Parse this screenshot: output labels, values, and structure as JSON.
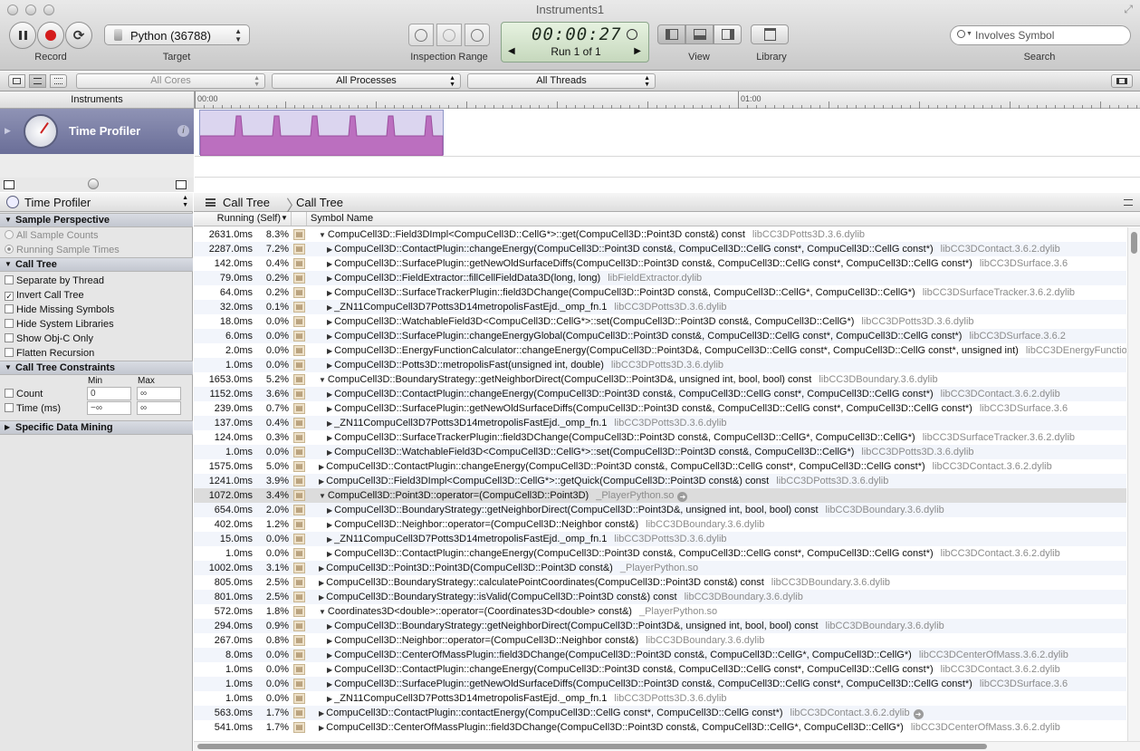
{
  "window": {
    "title": "Instruments1"
  },
  "toolbar": {
    "record_label": "Record",
    "target_label": "Target",
    "target_value": "Python (36788)",
    "inspection_label": "Inspection Range",
    "timer": "00:00:27",
    "run_label": "Run 1 of 1",
    "view_label": "View",
    "library_label": "Library",
    "search_placeholder": "Involves Symbol",
    "search_label": "Search"
  },
  "scopebar": {
    "cores": "All Cores",
    "processes": "All Processes",
    "threads": "All Threads"
  },
  "instruments": {
    "header": "Instruments",
    "ruler_ticks": [
      "00:00",
      "01:00"
    ],
    "items": [
      {
        "name": "Time Profiler",
        "info": "i"
      }
    ]
  },
  "left_panel": {
    "title": "Time Profiler",
    "sections": {
      "sample_perspective": "Sample Perspective",
      "call_tree": "Call Tree",
      "constraints": "Call Tree Constraints",
      "data_mining": "Specific Data Mining"
    },
    "perspective_options": [
      "All Sample Counts",
      "Running Sample Times"
    ],
    "call_tree_options": [
      {
        "label": "Separate by Thread",
        "checked": false
      },
      {
        "label": "Invert Call Tree",
        "checked": true
      },
      {
        "label": "Hide Missing Symbols",
        "checked": false
      },
      {
        "label": "Hide System Libraries",
        "checked": false
      },
      {
        "label": "Show Obj-C Only",
        "checked": false
      },
      {
        "label": "Flatten Recursion",
        "checked": false
      }
    ],
    "constraints": {
      "min_label": "Min",
      "max_label": "Max",
      "count_label": "Count",
      "count_min": "0",
      "count_max": "∞",
      "time_label": "Time (ms)",
      "time_min": "−∞",
      "time_max": "∞"
    }
  },
  "detail": {
    "breadcrumb": [
      "Call Tree",
      "Call Tree"
    ],
    "columns": {
      "running": "Running (Self)",
      "symbol": "Symbol Name"
    },
    "rows": [
      {
        "ms": "2631.0ms",
        "pct": "8.3%",
        "indent": 0,
        "tri": "▼",
        "sym": "CompuCell3D::Field3DImpl<CompuCell3D::CellG*>::get(CompuCell3D::Point3D const&) const",
        "lib": "libCC3DPotts3D.3.6.dylib"
      },
      {
        "ms": "2287.0ms",
        "pct": "7.2%",
        "indent": 1,
        "tri": "▶",
        "sym": "CompuCell3D::ContactPlugin::changeEnergy(CompuCell3D::Point3D const&, CompuCell3D::CellG const*, CompuCell3D::CellG const*)",
        "lib": "libCC3DContact.3.6.2.dylib"
      },
      {
        "ms": "142.0ms",
        "pct": "0.4%",
        "indent": 1,
        "tri": "▶",
        "sym": "CompuCell3D::SurfacePlugin::getNewOldSurfaceDiffs(CompuCell3D::Point3D const&, CompuCell3D::CellG const*, CompuCell3D::CellG const*)",
        "lib": "libCC3DSurface.3.6"
      },
      {
        "ms": "79.0ms",
        "pct": "0.2%",
        "indent": 1,
        "tri": "▶",
        "sym": "CompuCell3D::FieldExtractor::fillCellFieldData3D(long, long)",
        "lib": "libFieldExtractor.dylib"
      },
      {
        "ms": "64.0ms",
        "pct": "0.2%",
        "indent": 1,
        "tri": "▶",
        "sym": "CompuCell3D::SurfaceTrackerPlugin::field3DChange(CompuCell3D::Point3D const&, CompuCell3D::CellG*, CompuCell3D::CellG*)",
        "lib": "libCC3DSurfaceTracker.3.6.2.dylib"
      },
      {
        "ms": "32.0ms",
        "pct": "0.1%",
        "indent": 1,
        "tri": "▶",
        "sym": "_ZN11CompuCell3D7Potts3D14metropolisFastEjd._omp_fn.1",
        "lib": "libCC3DPotts3D.3.6.dylib"
      },
      {
        "ms": "18.0ms",
        "pct": "0.0%",
        "indent": 1,
        "tri": "▶",
        "sym": "CompuCell3D::WatchableField3D<CompuCell3D::CellG*>::set(CompuCell3D::Point3D const&, CompuCell3D::CellG*)",
        "lib": "libCC3DPotts3D.3.6.dylib"
      },
      {
        "ms": "6.0ms",
        "pct": "0.0%",
        "indent": 1,
        "tri": "▶",
        "sym": "CompuCell3D::SurfacePlugin::changeEnergyGlobal(CompuCell3D::Point3D const&, CompuCell3D::CellG const*, CompuCell3D::CellG const*)",
        "lib": "libCC3DSurface.3.6.2"
      },
      {
        "ms": "2.0ms",
        "pct": "0.0%",
        "indent": 1,
        "tri": "▶",
        "sym": "CompuCell3D::EnergyFunctionCalculator::changeEnergy(CompuCell3D::Point3D&, CompuCell3D::CellG const*, CompuCell3D::CellG const*, unsigned int)",
        "lib": "libCC3DEnergyFunctionCalculator"
      },
      {
        "ms": "1.0ms",
        "pct": "0.0%",
        "indent": 1,
        "tri": "▶",
        "sym": "CompuCell3D::Potts3D::metropolisFast(unsigned int, double)",
        "lib": "libCC3DPotts3D.3.6.dylib"
      },
      {
        "ms": "1653.0ms",
        "pct": "5.2%",
        "indent": 0,
        "tri": "▼",
        "sym": "CompuCell3D::BoundaryStrategy::getNeighborDirect(CompuCell3D::Point3D&, unsigned int, bool, bool) const",
        "lib": "libCC3DBoundary.3.6.dylib"
      },
      {
        "ms": "1152.0ms",
        "pct": "3.6%",
        "indent": 1,
        "tri": "▶",
        "sym": "CompuCell3D::ContactPlugin::changeEnergy(CompuCell3D::Point3D const&, CompuCell3D::CellG const*, CompuCell3D::CellG const*)",
        "lib": "libCC3DContact.3.6.2.dylib"
      },
      {
        "ms": "239.0ms",
        "pct": "0.7%",
        "indent": 1,
        "tri": "▶",
        "sym": "CompuCell3D::SurfacePlugin::getNewOldSurfaceDiffs(CompuCell3D::Point3D const&, CompuCell3D::CellG const*, CompuCell3D::CellG const*)",
        "lib": "libCC3DSurface.3.6"
      },
      {
        "ms": "137.0ms",
        "pct": "0.4%",
        "indent": 1,
        "tri": "▶",
        "sym": "_ZN11CompuCell3D7Potts3D14metropolisFastEjd._omp_fn.1",
        "lib": "libCC3DPotts3D.3.6.dylib"
      },
      {
        "ms": "124.0ms",
        "pct": "0.3%",
        "indent": 1,
        "tri": "▶",
        "sym": "CompuCell3D::SurfaceTrackerPlugin::field3DChange(CompuCell3D::Point3D const&, CompuCell3D::CellG*, CompuCell3D::CellG*)",
        "lib": "libCC3DSurfaceTracker.3.6.2.dylib"
      },
      {
        "ms": "1.0ms",
        "pct": "0.0%",
        "indent": 1,
        "tri": "▶",
        "sym": "CompuCell3D::WatchableField3D<CompuCell3D::CellG*>::set(CompuCell3D::Point3D const&, CompuCell3D::CellG*)",
        "lib": "libCC3DPotts3D.3.6.dylib"
      },
      {
        "ms": "1575.0ms",
        "pct": "5.0%",
        "indent": 0,
        "tri": "▶",
        "sym": "CompuCell3D::ContactPlugin::changeEnergy(CompuCell3D::Point3D const&, CompuCell3D::CellG const*, CompuCell3D::CellG const*)",
        "lib": "libCC3DContact.3.6.2.dylib"
      },
      {
        "ms": "1241.0ms",
        "pct": "3.9%",
        "indent": 0,
        "tri": "▶",
        "sym": "CompuCell3D::Field3DImpl<CompuCell3D::CellG*>::getQuick(CompuCell3D::Point3D const&) const",
        "lib": "libCC3DPotts3D.3.6.dylib"
      },
      {
        "ms": "1072.0ms",
        "pct": "3.4%",
        "indent": 0,
        "tri": "▼",
        "sym": "CompuCell3D::Point3D::operator=(CompuCell3D::Point3D)",
        "lib": "_PlayerPython.so",
        "hl": true,
        "go": true
      },
      {
        "ms": "654.0ms",
        "pct": "2.0%",
        "indent": 1,
        "tri": "▶",
        "sym": "CompuCell3D::BoundaryStrategy::getNeighborDirect(CompuCell3D::Point3D&, unsigned int, bool, bool) const",
        "lib": "libCC3DBoundary.3.6.dylib"
      },
      {
        "ms": "402.0ms",
        "pct": "1.2%",
        "indent": 1,
        "tri": "▶",
        "sym": "CompuCell3D::Neighbor::operator=(CompuCell3D::Neighbor const&)",
        "lib": "libCC3DBoundary.3.6.dylib"
      },
      {
        "ms": "15.0ms",
        "pct": "0.0%",
        "indent": 1,
        "tri": "▶",
        "sym": "_ZN11CompuCell3D7Potts3D14metropolisFastEjd._omp_fn.1",
        "lib": "libCC3DPotts3D.3.6.dylib"
      },
      {
        "ms": "1.0ms",
        "pct": "0.0%",
        "indent": 1,
        "tri": "▶",
        "sym": "CompuCell3D::ContactPlugin::changeEnergy(CompuCell3D::Point3D const&, CompuCell3D::CellG const*, CompuCell3D::CellG const*)",
        "lib": "libCC3DContact.3.6.2.dylib"
      },
      {
        "ms": "1002.0ms",
        "pct": "3.1%",
        "indent": 0,
        "tri": "▶",
        "sym": "CompuCell3D::Point3D::Point3D(CompuCell3D::Point3D const&)",
        "lib": "_PlayerPython.so"
      },
      {
        "ms": "805.0ms",
        "pct": "2.5%",
        "indent": 0,
        "tri": "▶",
        "sym": "CompuCell3D::BoundaryStrategy::calculatePointCoordinates(CompuCell3D::Point3D const&) const",
        "lib": "libCC3DBoundary.3.6.dylib"
      },
      {
        "ms": "801.0ms",
        "pct": "2.5%",
        "indent": 0,
        "tri": "▶",
        "sym": "CompuCell3D::BoundaryStrategy::isValid(CompuCell3D::Point3D const&) const",
        "lib": "libCC3DBoundary.3.6.dylib"
      },
      {
        "ms": "572.0ms",
        "pct": "1.8%",
        "indent": 0,
        "tri": "▼",
        "sym": "Coordinates3D<double>::operator=(Coordinates3D<double> const&)",
        "lib": "_PlayerPython.so"
      },
      {
        "ms": "294.0ms",
        "pct": "0.9%",
        "indent": 1,
        "tri": "▶",
        "sym": "CompuCell3D::BoundaryStrategy::getNeighborDirect(CompuCell3D::Point3D&, unsigned int, bool, bool) const",
        "lib": "libCC3DBoundary.3.6.dylib"
      },
      {
        "ms": "267.0ms",
        "pct": "0.8%",
        "indent": 1,
        "tri": "▶",
        "sym": "CompuCell3D::Neighbor::operator=(CompuCell3D::Neighbor const&)",
        "lib": "libCC3DBoundary.3.6.dylib"
      },
      {
        "ms": "8.0ms",
        "pct": "0.0%",
        "indent": 1,
        "tri": "▶",
        "sym": "CompuCell3D::CenterOfMassPlugin::field3DChange(CompuCell3D::Point3D const&, CompuCell3D::CellG*, CompuCell3D::CellG*)",
        "lib": "libCC3DCenterOfMass.3.6.2.dylib"
      },
      {
        "ms": "1.0ms",
        "pct": "0.0%",
        "indent": 1,
        "tri": "▶",
        "sym": "CompuCell3D::ContactPlugin::changeEnergy(CompuCell3D::Point3D const&, CompuCell3D::CellG const*, CompuCell3D::CellG const*)",
        "lib": "libCC3DContact.3.6.2.dylib"
      },
      {
        "ms": "1.0ms",
        "pct": "0.0%",
        "indent": 1,
        "tri": "▶",
        "sym": "CompuCell3D::SurfacePlugin::getNewOldSurfaceDiffs(CompuCell3D::Point3D const&, CompuCell3D::CellG const*, CompuCell3D::CellG const*)",
        "lib": "libCC3DSurface.3.6"
      },
      {
        "ms": "1.0ms",
        "pct": "0.0%",
        "indent": 1,
        "tri": "▶",
        "sym": "_ZN11CompuCell3D7Potts3D14metropolisFastEjd._omp_fn.1",
        "lib": "libCC3DPotts3D.3.6.dylib"
      },
      {
        "ms": "563.0ms",
        "pct": "1.7%",
        "indent": 0,
        "tri": "▶",
        "sym": "CompuCell3D::ContactPlugin::contactEnergy(CompuCell3D::CellG const*, CompuCell3D::CellG const*)",
        "lib": "libCC3DContact.3.6.2.dylib",
        "go": true
      },
      {
        "ms": "541.0ms",
        "pct": "1.7%",
        "indent": 0,
        "tri": "▶",
        "sym": "CompuCell3D::CenterOfMassPlugin::field3DChange(CompuCell3D::Point3D const&, CompuCell3D::CellG*, CompuCell3D::CellG*)",
        "lib": "libCC3DCenterOfMass.3.6.2.dylib"
      }
    ]
  },
  "colors": {
    "record": "#d41c1c",
    "instrument_row": "#7d82aa",
    "graph_fill": "#bb6fbf",
    "selection": "#dbd5ef"
  }
}
